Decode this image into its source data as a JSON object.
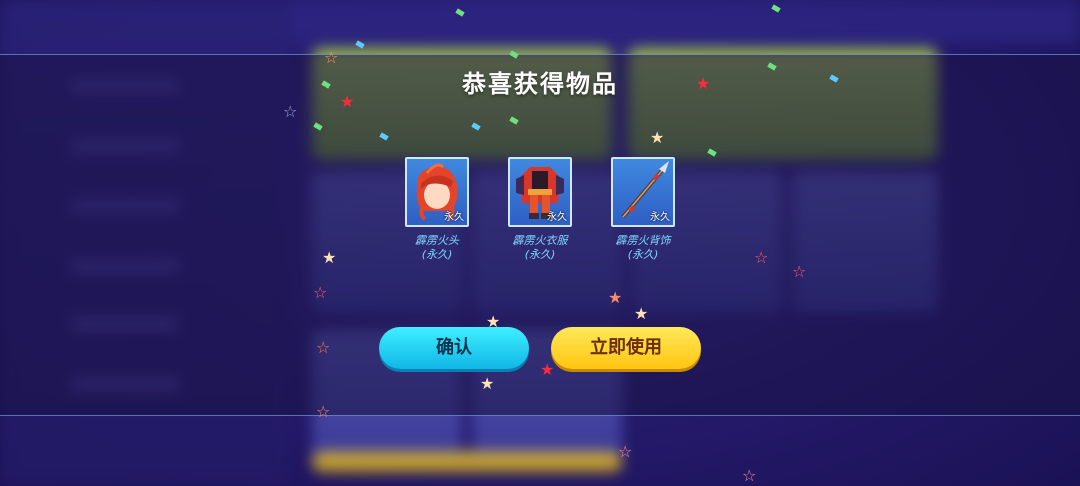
{
  "dialog": {
    "title": "恭喜获得物品",
    "items": [
      {
        "name": "霹雳火头",
        "duration": "(永久)",
        "badge": "永久",
        "icon": "red-hair-head-icon"
      },
      {
        "name": "霹雳火衣服",
        "duration": "(永久)",
        "badge": "永久",
        "icon": "red-outfit-icon"
      },
      {
        "name": "霹雳火背饰",
        "duration": "(永久)",
        "badge": "永久",
        "icon": "spear-back-accessory-icon"
      }
    ],
    "confirm_label": "确认",
    "use_label": "立即使用"
  },
  "colors": {
    "confirm": "#1fd0f5",
    "use": "#ffd21e",
    "item_name": "#7fd6ff",
    "frame": "#3f89e0"
  }
}
